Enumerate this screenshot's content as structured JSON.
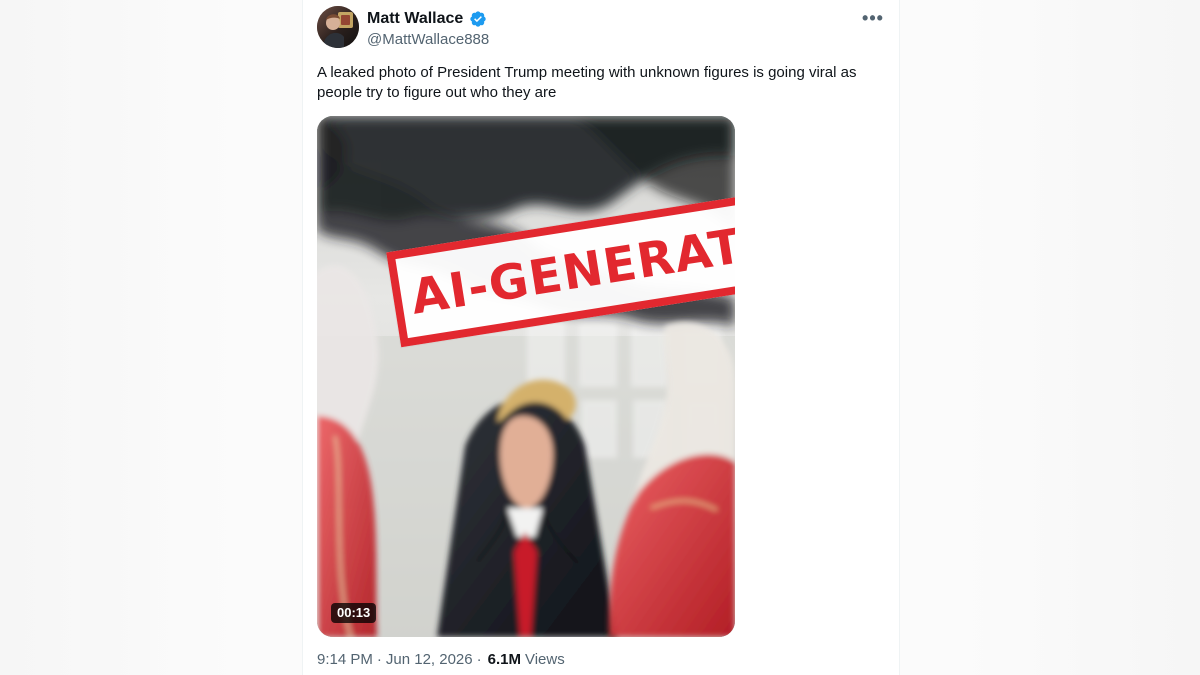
{
  "tweet": {
    "author": {
      "display_name": "Matt Wallace",
      "handle": "@MattWallace888",
      "verified_icon": "verified-badge-icon",
      "avatar_icon": "profile-avatar"
    },
    "more_options": "•••",
    "text": "A leaked photo of President Trump meeting with unknown figures is going viral as people try to figure out who they are",
    "media": {
      "stamp_text": "AI-GENERATED",
      "duration": "00:13"
    },
    "footer": {
      "time": "9:14 PM",
      "separator": "·",
      "date": "Jun 12, 2026",
      "views_count": "6.1M",
      "views_label": "Views"
    }
  }
}
